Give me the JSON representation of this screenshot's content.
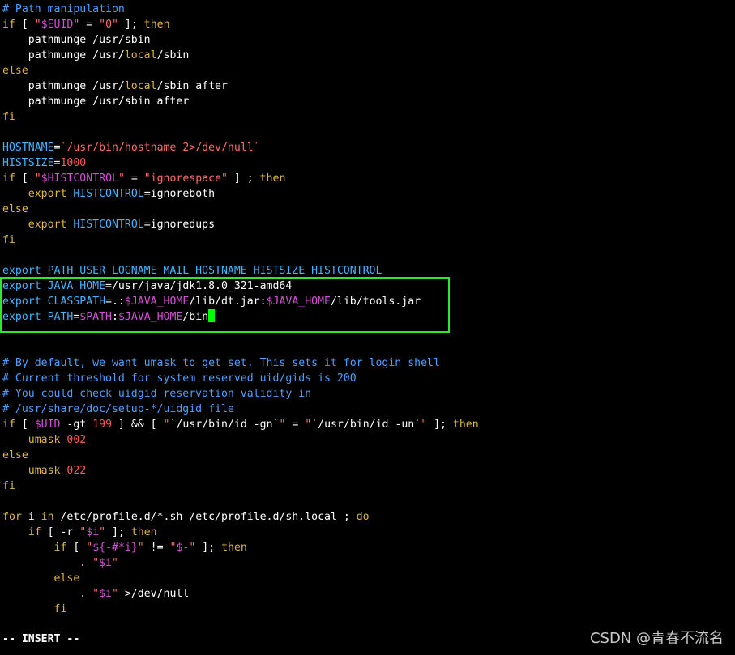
{
  "editor": {
    "mode": "-- INSERT --",
    "watermark": "CSDN @青春不流名",
    "colors": {
      "background": "#000000",
      "plain": "#ffffff",
      "comment": "#4aa0ff",
      "keyword": "#e0b63a",
      "variable": "#d54fd5",
      "string": "#ff6b6b",
      "number": "#ff5656",
      "identifier": "#41b5ff",
      "highlight_border": "#2ee62e",
      "cursor": "#00ff00"
    },
    "lines": [
      [
        [
          "comment",
          "# Path manipulation"
        ]
      ],
      [
        [
          "keyword",
          "if"
        ],
        [
          "plain",
          " [ "
        ],
        [
          "string",
          "\""
        ],
        [
          "var",
          "$EUID"
        ],
        [
          "string",
          "\""
        ],
        [
          "plain",
          " = "
        ],
        [
          "string",
          "\"0\""
        ],
        [
          "plain",
          " ]; "
        ],
        [
          "keyword",
          "then"
        ]
      ],
      [
        [
          "plain",
          "    pathmunge /usr/sbin"
        ]
      ],
      [
        [
          "plain",
          "    pathmunge /usr/"
        ],
        [
          "keyword",
          "local"
        ],
        [
          "plain",
          "/sbin"
        ]
      ],
      [
        [
          "keyword",
          "else"
        ]
      ],
      [
        [
          "plain",
          "    pathmunge /usr/"
        ],
        [
          "keyword",
          "local"
        ],
        [
          "plain",
          "/sbin after"
        ]
      ],
      [
        [
          "plain",
          "    pathmunge /usr/sbin after"
        ]
      ],
      [
        [
          "keyword",
          "fi"
        ]
      ],
      [],
      [
        [
          "ident",
          "HOSTNAME"
        ],
        [
          "plain",
          "="
        ],
        [
          "string",
          "`/usr/bin/hostname 2>/dev/null`"
        ]
      ],
      [
        [
          "ident",
          "HISTSIZE"
        ],
        [
          "plain",
          "="
        ],
        [
          "number",
          "1000"
        ]
      ],
      [
        [
          "keyword",
          "if"
        ],
        [
          "plain",
          " [ "
        ],
        [
          "string",
          "\""
        ],
        [
          "var",
          "$HISTCONTROL"
        ],
        [
          "string",
          "\""
        ],
        [
          "plain",
          " = "
        ],
        [
          "string",
          "\"ignorespace\""
        ],
        [
          "plain",
          " ] ; "
        ],
        [
          "keyword",
          "then"
        ]
      ],
      [
        [
          "plain",
          "    "
        ],
        [
          "keyword",
          "export"
        ],
        [
          "plain",
          " "
        ],
        [
          "ident",
          "HISTCONTROL"
        ],
        [
          "plain",
          "=ignoreboth"
        ]
      ],
      [
        [
          "keyword",
          "else"
        ]
      ],
      [
        [
          "plain",
          "    "
        ],
        [
          "keyword",
          "export"
        ],
        [
          "plain",
          " "
        ],
        [
          "ident",
          "HISTCONTROL"
        ],
        [
          "plain",
          "=ignoredups"
        ]
      ],
      [
        [
          "keyword",
          "fi"
        ]
      ],
      [],
      [
        [
          "ident",
          "export PATH USER LOGNAME MAIL HOSTNAME HISTSIZE HISTCONTROL"
        ]
      ],
      [
        [
          "ident",
          "export JAVA_HOME"
        ],
        [
          "plain",
          "=/usr/java/jdk1.8.0_321-amd64"
        ]
      ],
      [
        [
          "ident",
          "export CLASSPATH"
        ],
        [
          "plain",
          "=.:"
        ],
        [
          "var",
          "$JAVA_HOME"
        ],
        [
          "plain",
          "/lib/dt.jar:"
        ],
        [
          "var",
          "$JAVA_HOME"
        ],
        [
          "plain",
          "/lib/tools.jar"
        ]
      ],
      [
        [
          "ident",
          "export PATH"
        ],
        [
          "plain",
          "="
        ],
        [
          "var",
          "$PATH"
        ],
        [
          "plain",
          ":"
        ],
        [
          "var",
          "$JAVA_HOME"
        ],
        [
          "plain",
          "/bin"
        ]
      ],
      [],
      [],
      [
        [
          "comment",
          "# By default, we want umask to get set. This sets it for login shell"
        ]
      ],
      [
        [
          "comment",
          "# Current threshold for system reserved uid/gids is 200"
        ]
      ],
      [
        [
          "comment",
          "# You could check uidgid reservation validity in"
        ]
      ],
      [
        [
          "comment",
          "# /usr/share/doc/setup-*/uidgid file"
        ]
      ],
      [
        [
          "keyword",
          "if"
        ],
        [
          "plain",
          " [ "
        ],
        [
          "var",
          "$UID"
        ],
        [
          "plain",
          " -gt "
        ],
        [
          "number",
          "199"
        ],
        [
          "plain",
          " ] && [ "
        ],
        [
          "string",
          "\""
        ],
        [
          "plain",
          "`/usr/bin/id -gn`"
        ],
        [
          "string",
          "\""
        ],
        [
          "plain",
          " = "
        ],
        [
          "string",
          "\""
        ],
        [
          "plain",
          "`/usr/bin/id -un`"
        ],
        [
          "string",
          "\""
        ],
        [
          "plain",
          " ]; "
        ],
        [
          "keyword",
          "then"
        ]
      ],
      [
        [
          "plain",
          "    "
        ],
        [
          "keyword",
          "umask"
        ],
        [
          "plain",
          " "
        ],
        [
          "number",
          "002"
        ]
      ],
      [
        [
          "keyword",
          "else"
        ]
      ],
      [
        [
          "plain",
          "    "
        ],
        [
          "keyword",
          "umask"
        ],
        [
          "plain",
          " "
        ],
        [
          "number",
          "022"
        ]
      ],
      [
        [
          "keyword",
          "fi"
        ]
      ],
      [],
      [
        [
          "keyword",
          "for"
        ],
        [
          "plain",
          " i "
        ],
        [
          "keyword",
          "in"
        ],
        [
          "plain",
          " /etc/profile.d/*.sh /etc/profile.d/sh.local ; "
        ],
        [
          "keyword",
          "do"
        ]
      ],
      [
        [
          "plain",
          "    "
        ],
        [
          "keyword",
          "if"
        ],
        [
          "plain",
          " [ -r "
        ],
        [
          "string",
          "\""
        ],
        [
          "var",
          "$i"
        ],
        [
          "string",
          "\""
        ],
        [
          "plain",
          " ]; "
        ],
        [
          "keyword",
          "then"
        ]
      ],
      [
        [
          "plain",
          "        "
        ],
        [
          "keyword",
          "if"
        ],
        [
          "plain",
          " [ "
        ],
        [
          "string",
          "\""
        ],
        [
          "var",
          "${-#*i}"
        ],
        [
          "string",
          "\""
        ],
        [
          "plain",
          " != "
        ],
        [
          "string",
          "\""
        ],
        [
          "var",
          "$-"
        ],
        [
          "string",
          "\""
        ],
        [
          "plain",
          " ]; "
        ],
        [
          "keyword",
          "then"
        ]
      ],
      [
        [
          "plain",
          "            . "
        ],
        [
          "string",
          "\""
        ],
        [
          "var",
          "$i"
        ],
        [
          "string",
          "\""
        ]
      ],
      [
        [
          "plain",
          "        "
        ],
        [
          "keyword",
          "else"
        ]
      ],
      [
        [
          "plain",
          "            . "
        ],
        [
          "string",
          "\""
        ],
        [
          "var",
          "$i"
        ],
        [
          "string",
          "\""
        ],
        [
          "plain",
          " >/dev/null"
        ]
      ],
      [
        [
          "plain",
          "        "
        ],
        [
          "keyword",
          "fi"
        ]
      ]
    ]
  }
}
